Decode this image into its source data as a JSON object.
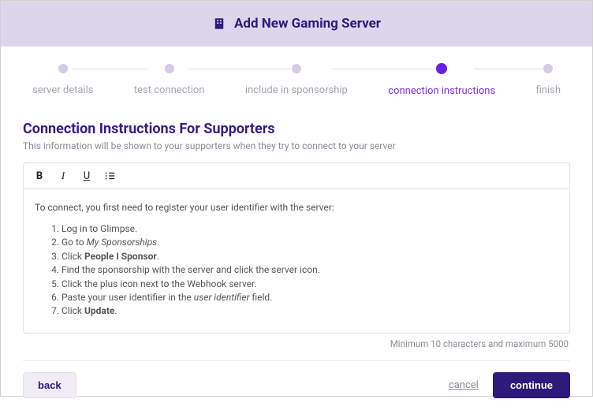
{
  "header": {
    "title": "Add New Gaming Server"
  },
  "steps": [
    {
      "label": "server details"
    },
    {
      "label": "test connection"
    },
    {
      "label": "include in sponsorship"
    },
    {
      "label": "connection instructions"
    },
    {
      "label": "finish"
    }
  ],
  "section": {
    "title": "Connection Instructions For Supporters",
    "subtitle": "This information will be shown to your supporters when they try to connect to your server"
  },
  "editor": {
    "intro": "To connect, you first need to register your user identifier with the server:",
    "steps_html": [
      "Log in to Glimpse.",
      "Go to <em>My Sponsorships</em>.",
      "Click <strong>People I Sponsor</strong>.",
      "Find the sponsorship with the server and click the server icon.",
      "Click the plus icon next to the Webhook server.",
      "Paste your user identifier in the <em>user identifier</em> field.",
      "Click <strong>Update</strong>."
    ],
    "char_limit": "Minimum 10 characters and maximum 5000"
  },
  "actions": {
    "back": "back",
    "cancel": "cancel",
    "continue": "continue"
  }
}
